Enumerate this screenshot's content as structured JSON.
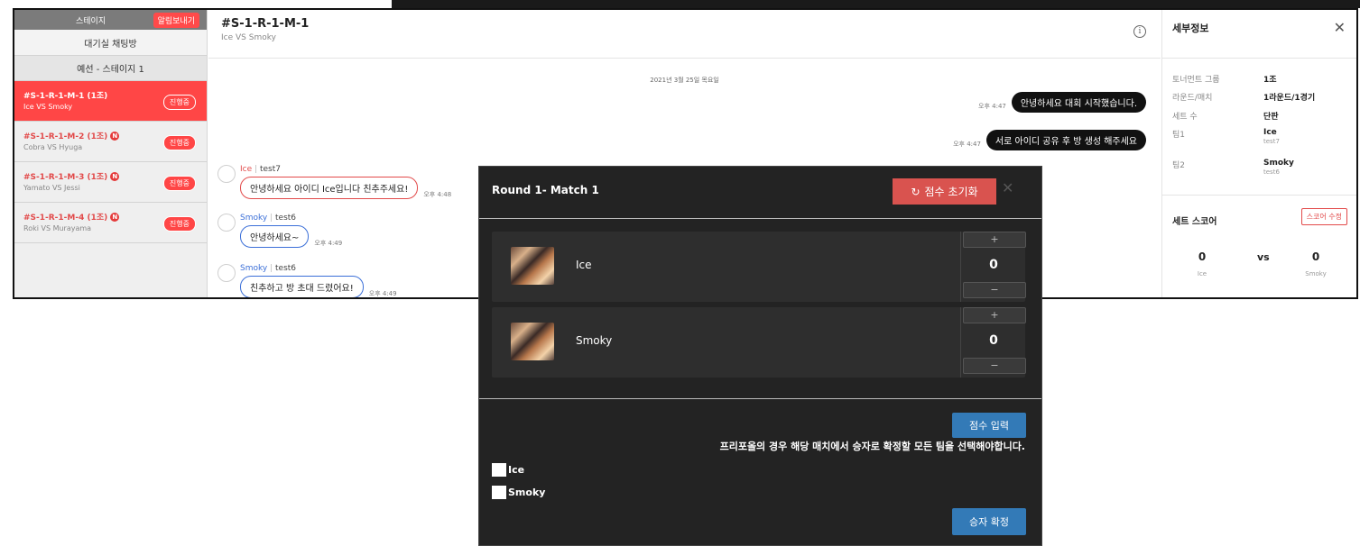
{
  "sidebar": {
    "stage_label": "스테이지",
    "alert_button": "알림보내기",
    "room_label": "대기실 채팅방",
    "group_label": "예선 - 스테이지 1",
    "matches": [
      {
        "title": "#S-1-R-1-M-1 (1조)",
        "teams": "Ice VS Smoky",
        "state": "진행중",
        "new_badge": ""
      },
      {
        "title": "#S-1-R-1-M-2 (1조)",
        "teams": "Cobra VS Hyuga",
        "state": "진행중",
        "new_badge": "N"
      },
      {
        "title": "#S-1-R-1-M-3 (1조)",
        "teams": "Yamato VS Jessi",
        "state": "진행중",
        "new_badge": "N"
      },
      {
        "title": "#S-1-R-1-M-4 (1조)",
        "teams": "Roki VS Murayama",
        "state": "진행중",
        "new_badge": "N"
      }
    ]
  },
  "chat": {
    "title": "#S-1-R-1-M-1",
    "subtitle": "Ice VS Smoky",
    "date": "2021년 3월 25일 목요일",
    "admin_messages": [
      {
        "text": "안녕하세요 대회 시작했습니다.",
        "time": "오후 4:47"
      },
      {
        "text": "서로 아이디 공유 후 방 생성 해주세요",
        "time": "오후 4:47"
      }
    ],
    "user_messages": [
      {
        "name": "Ice",
        "id": "test7",
        "text": "안녕하세요 아이디 Ice입니다 친추주세요!",
        "time": "오후 4:48"
      },
      {
        "name": "Smoky",
        "id": "test6",
        "text": "안녕하세요~",
        "time": "오후 4:49"
      },
      {
        "name": "Smoky",
        "id": "test6",
        "text": "친추하고 방 초대 드렸어요!",
        "time": "오후 4:49"
      }
    ],
    "separator": "|"
  },
  "detail": {
    "title": "세부정보",
    "close": "✕",
    "fields": [
      {
        "key": "토너먼트 그룹",
        "value": "1조",
        "sub": ""
      },
      {
        "key": "라운드/매치",
        "value": "1라운드/1경기",
        "sub": ""
      },
      {
        "key": "세트 수",
        "value": "단판",
        "sub": ""
      },
      {
        "key": "팀1",
        "value": "Ice",
        "sub": "test7"
      },
      {
        "key": "팀2",
        "value": "Smoky",
        "sub": "test6"
      }
    ],
    "set_score_title": "세트 스코어",
    "score_edit": "스코어 수정",
    "score_left": {
      "value": "0",
      "name": "Ice"
    },
    "score_right": {
      "value": "0",
      "name": "Smoky"
    },
    "vs": "vs"
  },
  "modal": {
    "title": "Round 1- Match 1",
    "reset_label": "점수 초기화",
    "reset_icon": "↻",
    "close": "✕",
    "teams": [
      {
        "name": "Ice",
        "score": "0"
      },
      {
        "name": "Smoky",
        "score": "0"
      }
    ],
    "plus": "+",
    "minus": "−",
    "score_input": "점수 입력",
    "note": "프리포올의 경우 해당 매치에서 승자로 확정할 모든 팀을 선택해야합니다.",
    "checkbox_labels": [
      "Ice",
      "Smoky"
    ],
    "confirm": "승자 확정"
  },
  "colors": {
    "accent_red": "#ff4646",
    "modal_bg": "#232323",
    "primary_blue": "#337ab7"
  }
}
